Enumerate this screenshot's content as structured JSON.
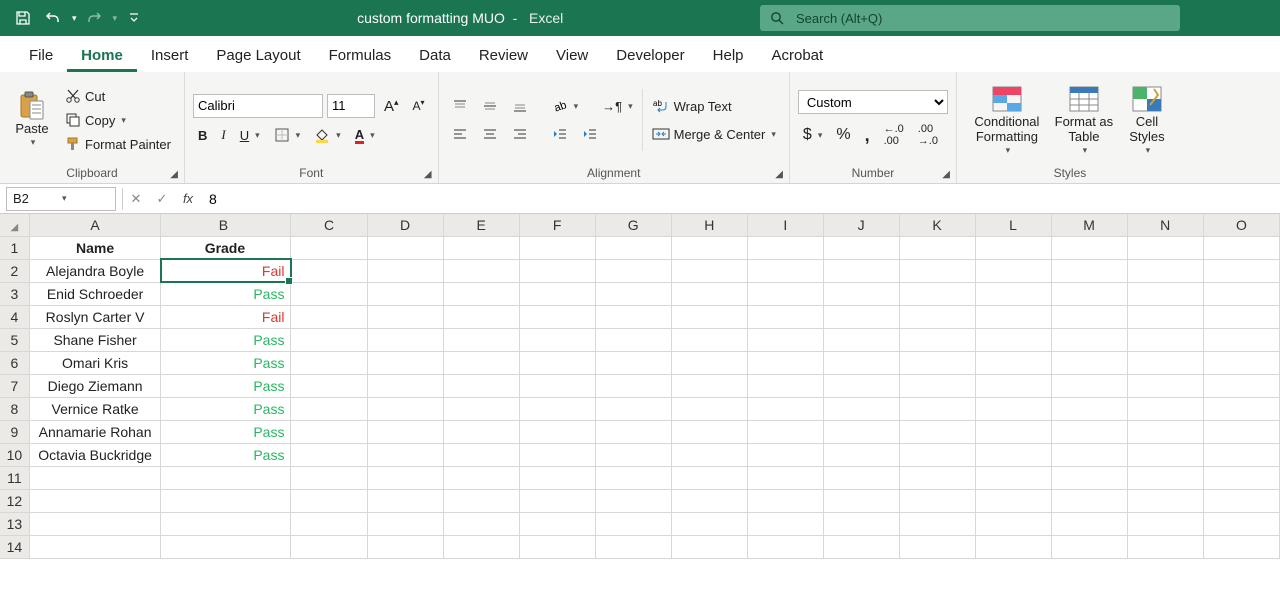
{
  "title": {
    "doc": "custom formatting MUO",
    "app": "Excel"
  },
  "search": {
    "placeholder": "Search (Alt+Q)"
  },
  "tabs": [
    "File",
    "Home",
    "Insert",
    "Page Layout",
    "Formulas",
    "Data",
    "Review",
    "View",
    "Developer",
    "Help",
    "Acrobat"
  ],
  "active_tab": "Home",
  "ribbon": {
    "clipboard": {
      "paste": "Paste",
      "cut": "Cut",
      "copy": "Copy",
      "painter": "Format Painter",
      "label": "Clipboard"
    },
    "font": {
      "name": "Calibri",
      "size": "11",
      "label": "Font"
    },
    "alignment": {
      "wrap": "Wrap Text",
      "merge": "Merge & Center",
      "label": "Alignment"
    },
    "number": {
      "format": "Custom",
      "label": "Number"
    },
    "styles": {
      "cond": "Conditional Formatting",
      "table": "Format as Table",
      "cell": "Cell Styles",
      "label": "Styles"
    }
  },
  "formula_bar": {
    "cell_ref": "B2",
    "value": "8"
  },
  "columns": [
    "A",
    "B",
    "C",
    "D",
    "E",
    "F",
    "G",
    "H",
    "I",
    "J",
    "K",
    "L",
    "M",
    "N",
    "O"
  ],
  "headers": {
    "A": "Name",
    "B": "Grade"
  },
  "selected_cell": "B2",
  "rows": [
    {
      "n": 2,
      "name": "Alejandra Boyle",
      "grade": "Fail",
      "cls": "fail"
    },
    {
      "n": 3,
      "name": "Enid Schroeder",
      "grade": "Pass",
      "cls": "pass"
    },
    {
      "n": 4,
      "name": "Roslyn Carter V",
      "grade": "Fail",
      "cls": "fail"
    },
    {
      "n": 5,
      "name": "Shane Fisher",
      "grade": "Pass",
      "cls": "pass"
    },
    {
      "n": 6,
      "name": "Omari Kris",
      "grade": "Pass",
      "cls": "pass"
    },
    {
      "n": 7,
      "name": "Diego Ziemann",
      "grade": "Pass",
      "cls": "pass"
    },
    {
      "n": 8,
      "name": "Vernice Ratke",
      "grade": "Pass",
      "cls": "pass"
    },
    {
      "n": 9,
      "name": "Annamarie Rohan",
      "grade": "Pass",
      "cls": "pass"
    },
    {
      "n": 10,
      "name": "Octavia Buckridge",
      "grade": "Pass",
      "cls": "pass"
    }
  ],
  "blank_rows": [
    11,
    12,
    13,
    14
  ]
}
